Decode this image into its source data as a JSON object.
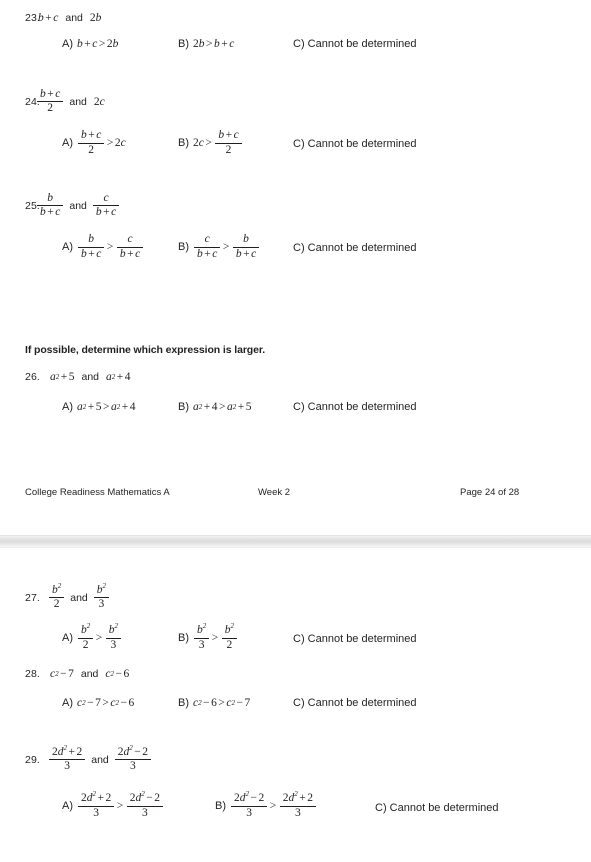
{
  "document": {
    "title": "College Readiness Mathematics A",
    "instruction_heading": "If possible, determine which expression is larger.",
    "connector_word": "and",
    "cannot_label": "C) Cannot be determined"
  },
  "footer": {
    "course": "College Readiness Mathematics A",
    "week": "Week 2",
    "page": "Page 24 of 28"
  },
  "labels": {
    "a": "A)",
    "b": "B)",
    "c": "C)",
    "gt": ">",
    "plus": "+",
    "minus": "−"
  },
  "questions": [
    {
      "number": "23.",
      "stem_left": "b+c",
      "stem_right": "2b",
      "choices": [
        {
          "label": "A)",
          "text": "b+c > 2b"
        },
        {
          "label": "B)",
          "text": "2b > b+c"
        },
        {
          "label": "C)",
          "text": "Cannot be determined"
        }
      ]
    },
    {
      "number": "24.",
      "stem_left_num": "b+c",
      "stem_left_den": "2",
      "stem_right": "2c",
      "choices": [
        {
          "label": "A)",
          "text": "(b+c)/2 > 2c"
        },
        {
          "label": "B)",
          "text": "2c > (b+c)/2"
        },
        {
          "label": "C)",
          "text": "Cannot be determined"
        }
      ]
    },
    {
      "number": "25.",
      "stem_left_num": "b",
      "stem_left_den": "b+c",
      "stem_right_num": "c",
      "stem_right_den": "b+c",
      "choices": [
        {
          "label": "A)",
          "text": "b/(b+c) > c/(b+c)"
        },
        {
          "label": "B)",
          "text": "c/(b+c) > b/(b+c)"
        },
        {
          "label": "C)",
          "text": "Cannot be determined"
        }
      ]
    },
    {
      "number": "26.",
      "stem_left": "a²+5",
      "stem_right": "a²+4",
      "choices": [
        {
          "label": "A)",
          "text": "a²+5 > a²+4"
        },
        {
          "label": "B)",
          "text": "a²+4 > a²+5"
        },
        {
          "label": "C)",
          "text": "Cannot be determined"
        }
      ]
    },
    {
      "number": "27.",
      "stem_left_num": "b²",
      "stem_left_den": "2",
      "stem_right_num": "b²",
      "stem_right_den": "3",
      "choices": [
        {
          "label": "A)",
          "text": "b²/2 > b²/3"
        },
        {
          "label": "B)",
          "text": "b²/3 > b²/2"
        },
        {
          "label": "C)",
          "text": "Cannot be determined"
        }
      ]
    },
    {
      "number": "28.",
      "stem_left": "c²−7",
      "stem_right": "c²−6",
      "choices": [
        {
          "label": "A)",
          "text": "c²−7 > c²−6"
        },
        {
          "label": "B)",
          "text": "c²−6 > c²−7"
        },
        {
          "label": "C)",
          "text": "Cannot be determined"
        }
      ]
    },
    {
      "number": "29.",
      "stem_left_num": "2d²+2",
      "stem_left_den": "3",
      "stem_right_num": "2d²−2",
      "stem_right_den": "3",
      "choices": [
        {
          "label": "A)",
          "text": "(2d²+2)/3 > (2d²−2)/3"
        },
        {
          "label": "B)",
          "text": "(2d²−2)/3 > (2d²+2)/3"
        },
        {
          "label": "C)",
          "text": "Cannot be determined"
        }
      ]
    }
  ],
  "symbols": {
    "var_a": "a",
    "var_b": "b",
    "var_c": "c",
    "var_d": "d",
    "two": "2",
    "three": "3",
    "four": "4",
    "five": "5",
    "six": "6",
    "seven": "7",
    "bc": "b+c",
    "two_b": "2b",
    "two_c": "2c"
  }
}
